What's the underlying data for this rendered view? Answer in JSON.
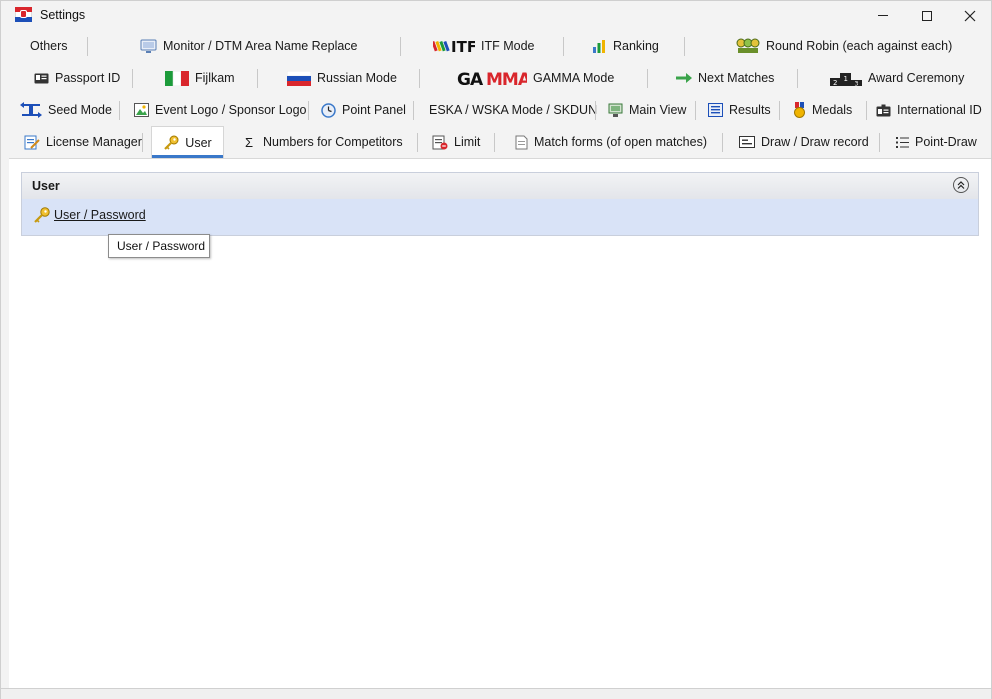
{
  "window": {
    "title": "Settings",
    "app_icon": "flag-app-icon",
    "controls": [
      "minimize-icon",
      "maximize-icon",
      "close-icon"
    ]
  },
  "tabs": {
    "row1": [
      {
        "label": "Others",
        "icon": ""
      },
      {
        "label": "Monitor / DTM Area Name Replace",
        "icon": "monitor-icon"
      },
      {
        "label": "ITF Mode",
        "icon": "itf-logo-icon"
      },
      {
        "label": "Ranking",
        "icon": "bar-chart-icon"
      },
      {
        "label": "Round Robin (each against each)",
        "icon": "round-robin-icon"
      }
    ],
    "row2": [
      {
        "label": "Passport ID",
        "icon": "id-card-icon"
      },
      {
        "label": "Fijlkam",
        "icon": "italy-flag-icon"
      },
      {
        "label": "Russian Mode",
        "icon": "russia-flag-icon"
      },
      {
        "label": "GAMMA Mode",
        "icon": "gamma-logo-icon"
      },
      {
        "label": "Next Matches",
        "icon": "arrow-right-icon"
      },
      {
        "label": "Award Ceremony",
        "icon": "podium-icon"
      }
    ],
    "row3": [
      {
        "label": "Seed Mode",
        "icon": "seed-arrows-icon"
      },
      {
        "label": "Event Logo / Sponsor Logo",
        "icon": "image-icon"
      },
      {
        "label": "Point Panel",
        "icon": "clock-icon"
      },
      {
        "label": "ESKA / WSKA Mode / SKDUN",
        "icon": ""
      },
      {
        "label": "Main View",
        "icon": "main-view-icon"
      },
      {
        "label": "Results",
        "icon": "results-list-icon"
      },
      {
        "label": "Medals",
        "icon": "medal-icon"
      },
      {
        "label": "International ID",
        "icon": "international-id-icon"
      }
    ],
    "row4": [
      {
        "label": "License Manager",
        "icon": "license-icon"
      },
      {
        "label": "User",
        "icon": "key-icon",
        "active": true
      },
      {
        "label": "Numbers for Competitors",
        "icon": "sigma-icon"
      },
      {
        "label": "Limit",
        "icon": "limit-icon"
      },
      {
        "label": "Match forms (of open matches)",
        "icon": "document-icon"
      },
      {
        "label": "Draw / Draw record",
        "icon": "draw-icon"
      },
      {
        "label": "Point-Draw",
        "icon": "list-icon"
      }
    ]
  },
  "user_panel": {
    "title": "User",
    "items": [
      {
        "label": "User / Password",
        "icon": "key-icon"
      }
    ],
    "tooltip": "User / Password"
  },
  "colors": {
    "active_tab_underline": "#3a78c9",
    "group_body": "#d9e3f7",
    "window_bg": "#f3f3f3"
  }
}
